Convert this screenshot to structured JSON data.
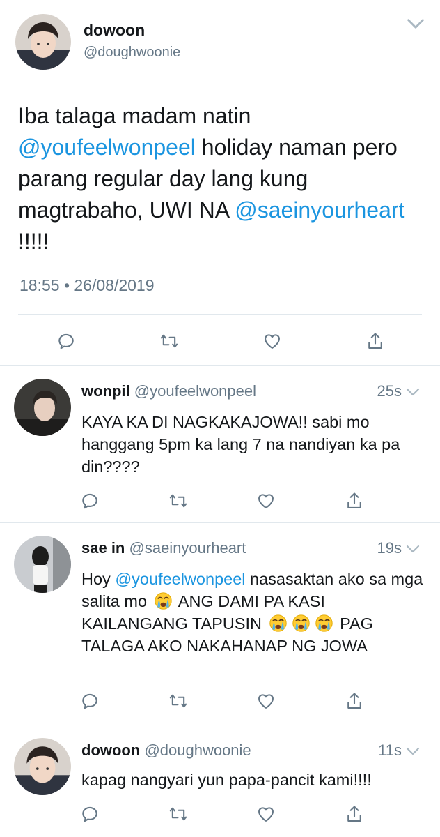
{
  "main_tweet": {
    "name": "dowoon",
    "handle": "@doughwoonie",
    "text_part1": "Iba talaga madam natin ",
    "mention1": "@youfeelwonpeel",
    "text_part2": " holiday naman pero parang regular day lang kung magtrabaho, UWI NA ",
    "mention2": "@saeinyourheart",
    "text_part3": " !!!!!",
    "timestamp": "18:55 • 26/08/2019"
  },
  "replies": [
    {
      "name": "wonpil",
      "handle": "@youfeelwonpeel",
      "time": "25s",
      "text": "KAYA KA DI NAGKAKAJOWA!! sabi mo hanggang 5pm ka lang 7 na nandiyan ka pa din????"
    },
    {
      "name": "sae in",
      "handle": "@saeinyourheart",
      "time": "19s",
      "text_pre": "Hoy ",
      "mention": "@youfeelwonpeel",
      "text_mid": " nasasaktan ako sa mga salita mo",
      "text_caps1": " ANG DAMI PA KASI KAILANGANG TAPUSIN",
      "text_caps2": " PAG TALAGA AKO NAKAHANAP NG JOWA"
    },
    {
      "name": "dowoon",
      "handle": "@doughwoonie",
      "time": "11s",
      "text": "kapag nangyari yun papa-pancit kami!!!!"
    }
  ],
  "icons": [
    "reply-icon",
    "retweet-icon",
    "like-icon",
    "share-icon",
    "chevron-down-icon",
    "crying-emoji"
  ],
  "colors": {
    "mention": "#1b95e0",
    "secondary_text": "#657786",
    "divider": "#e1e8ed"
  }
}
